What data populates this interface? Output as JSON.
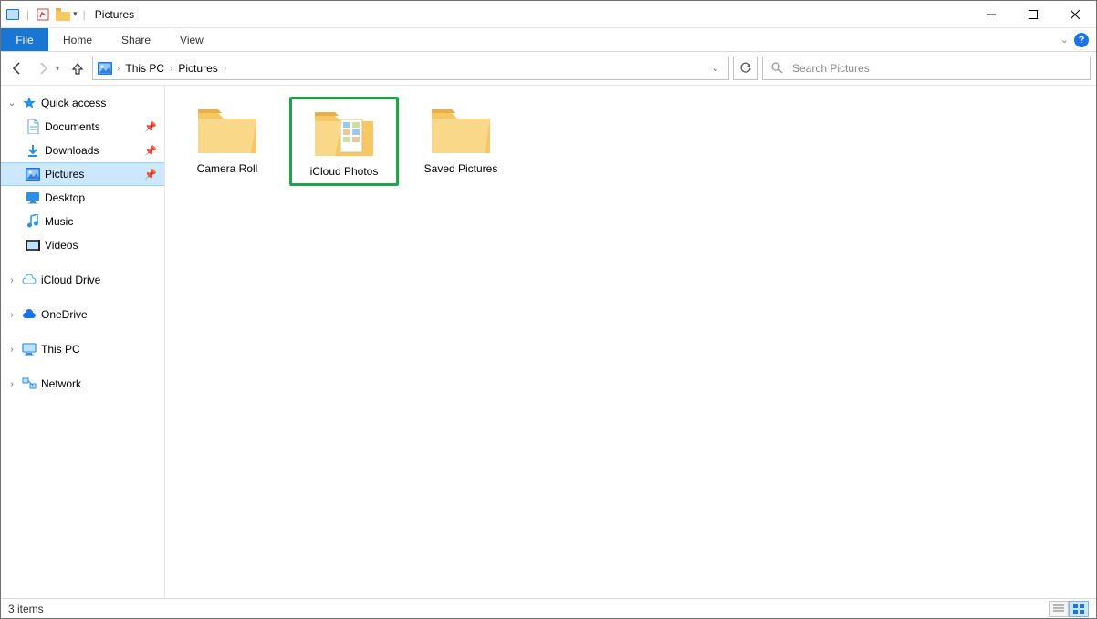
{
  "titlebar": {
    "app_title": "Pictures"
  },
  "ribbon": {
    "file_label": "File",
    "tabs": [
      "Home",
      "Share",
      "View"
    ]
  },
  "address": {
    "breadcrumbs": [
      "This PC",
      "Pictures"
    ]
  },
  "search": {
    "placeholder": "Search Pictures"
  },
  "sidebar": {
    "quick_access_label": "Quick access",
    "quick_items": [
      {
        "label": "Documents",
        "icon": "document-icon",
        "pinned": true
      },
      {
        "label": "Downloads",
        "icon": "download-icon",
        "pinned": true
      },
      {
        "label": "Pictures",
        "icon": "pictures-icon",
        "pinned": true,
        "selected": true
      },
      {
        "label": "Desktop",
        "icon": "desktop-icon",
        "pinned": false
      },
      {
        "label": "Music",
        "icon": "music-icon",
        "pinned": false
      },
      {
        "label": "Videos",
        "icon": "videos-icon",
        "pinned": false
      }
    ],
    "roots": [
      {
        "label": "iCloud Drive",
        "icon": "cloud-icon"
      },
      {
        "label": "OneDrive",
        "icon": "onedrive-icon"
      },
      {
        "label": "This PC",
        "icon": "thispc-icon"
      },
      {
        "label": "Network",
        "icon": "network-icon"
      }
    ]
  },
  "content": {
    "folders": [
      {
        "label": "Camera Roll",
        "highlighted": false,
        "variant": "empty"
      },
      {
        "label": "iCloud Photos",
        "highlighted": true,
        "variant": "preview"
      },
      {
        "label": "Saved Pictures",
        "highlighted": false,
        "variant": "empty"
      }
    ]
  },
  "statusbar": {
    "item_count_label": "3 items"
  }
}
